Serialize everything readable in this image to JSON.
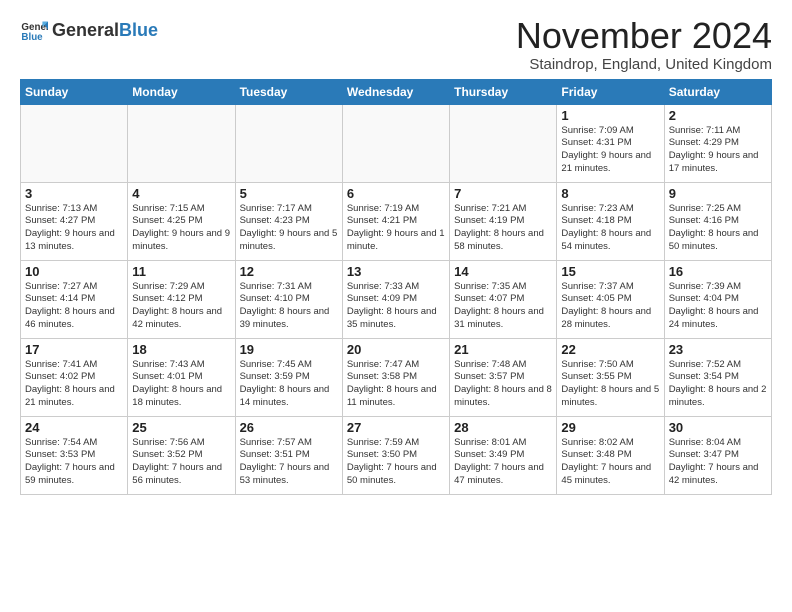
{
  "logo": {
    "general": "General",
    "blue": "Blue"
  },
  "title": "November 2024",
  "location": "Staindrop, England, United Kingdom",
  "days_of_week": [
    "Sunday",
    "Monday",
    "Tuesday",
    "Wednesday",
    "Thursday",
    "Friday",
    "Saturday"
  ],
  "weeks": [
    [
      {
        "day": "",
        "text": ""
      },
      {
        "day": "",
        "text": ""
      },
      {
        "day": "",
        "text": ""
      },
      {
        "day": "",
        "text": ""
      },
      {
        "day": "",
        "text": ""
      },
      {
        "day": "1",
        "text": "Sunrise: 7:09 AM\nSunset: 4:31 PM\nDaylight: 9 hours and 21 minutes."
      },
      {
        "day": "2",
        "text": "Sunrise: 7:11 AM\nSunset: 4:29 PM\nDaylight: 9 hours and 17 minutes."
      }
    ],
    [
      {
        "day": "3",
        "text": "Sunrise: 7:13 AM\nSunset: 4:27 PM\nDaylight: 9 hours and 13 minutes."
      },
      {
        "day": "4",
        "text": "Sunrise: 7:15 AM\nSunset: 4:25 PM\nDaylight: 9 hours and 9 minutes."
      },
      {
        "day": "5",
        "text": "Sunrise: 7:17 AM\nSunset: 4:23 PM\nDaylight: 9 hours and 5 minutes."
      },
      {
        "day": "6",
        "text": "Sunrise: 7:19 AM\nSunset: 4:21 PM\nDaylight: 9 hours and 1 minute."
      },
      {
        "day": "7",
        "text": "Sunrise: 7:21 AM\nSunset: 4:19 PM\nDaylight: 8 hours and 58 minutes."
      },
      {
        "day": "8",
        "text": "Sunrise: 7:23 AM\nSunset: 4:18 PM\nDaylight: 8 hours and 54 minutes."
      },
      {
        "day": "9",
        "text": "Sunrise: 7:25 AM\nSunset: 4:16 PM\nDaylight: 8 hours and 50 minutes."
      }
    ],
    [
      {
        "day": "10",
        "text": "Sunrise: 7:27 AM\nSunset: 4:14 PM\nDaylight: 8 hours and 46 minutes."
      },
      {
        "day": "11",
        "text": "Sunrise: 7:29 AM\nSunset: 4:12 PM\nDaylight: 8 hours and 42 minutes."
      },
      {
        "day": "12",
        "text": "Sunrise: 7:31 AM\nSunset: 4:10 PM\nDaylight: 8 hours and 39 minutes."
      },
      {
        "day": "13",
        "text": "Sunrise: 7:33 AM\nSunset: 4:09 PM\nDaylight: 8 hours and 35 minutes."
      },
      {
        "day": "14",
        "text": "Sunrise: 7:35 AM\nSunset: 4:07 PM\nDaylight: 8 hours and 31 minutes."
      },
      {
        "day": "15",
        "text": "Sunrise: 7:37 AM\nSunset: 4:05 PM\nDaylight: 8 hours and 28 minutes."
      },
      {
        "day": "16",
        "text": "Sunrise: 7:39 AM\nSunset: 4:04 PM\nDaylight: 8 hours and 24 minutes."
      }
    ],
    [
      {
        "day": "17",
        "text": "Sunrise: 7:41 AM\nSunset: 4:02 PM\nDaylight: 8 hours and 21 minutes."
      },
      {
        "day": "18",
        "text": "Sunrise: 7:43 AM\nSunset: 4:01 PM\nDaylight: 8 hours and 18 minutes."
      },
      {
        "day": "19",
        "text": "Sunrise: 7:45 AM\nSunset: 3:59 PM\nDaylight: 8 hours and 14 minutes."
      },
      {
        "day": "20",
        "text": "Sunrise: 7:47 AM\nSunset: 3:58 PM\nDaylight: 8 hours and 11 minutes."
      },
      {
        "day": "21",
        "text": "Sunrise: 7:48 AM\nSunset: 3:57 PM\nDaylight: 8 hours and 8 minutes."
      },
      {
        "day": "22",
        "text": "Sunrise: 7:50 AM\nSunset: 3:55 PM\nDaylight: 8 hours and 5 minutes."
      },
      {
        "day": "23",
        "text": "Sunrise: 7:52 AM\nSunset: 3:54 PM\nDaylight: 8 hours and 2 minutes."
      }
    ],
    [
      {
        "day": "24",
        "text": "Sunrise: 7:54 AM\nSunset: 3:53 PM\nDaylight: 7 hours and 59 minutes."
      },
      {
        "day": "25",
        "text": "Sunrise: 7:56 AM\nSunset: 3:52 PM\nDaylight: 7 hours and 56 minutes."
      },
      {
        "day": "26",
        "text": "Sunrise: 7:57 AM\nSunset: 3:51 PM\nDaylight: 7 hours and 53 minutes."
      },
      {
        "day": "27",
        "text": "Sunrise: 7:59 AM\nSunset: 3:50 PM\nDaylight: 7 hours and 50 minutes."
      },
      {
        "day": "28",
        "text": "Sunrise: 8:01 AM\nSunset: 3:49 PM\nDaylight: 7 hours and 47 minutes."
      },
      {
        "day": "29",
        "text": "Sunrise: 8:02 AM\nSunset: 3:48 PM\nDaylight: 7 hours and 45 minutes."
      },
      {
        "day": "30",
        "text": "Sunrise: 8:04 AM\nSunset: 3:47 PM\nDaylight: 7 hours and 42 minutes."
      }
    ]
  ]
}
